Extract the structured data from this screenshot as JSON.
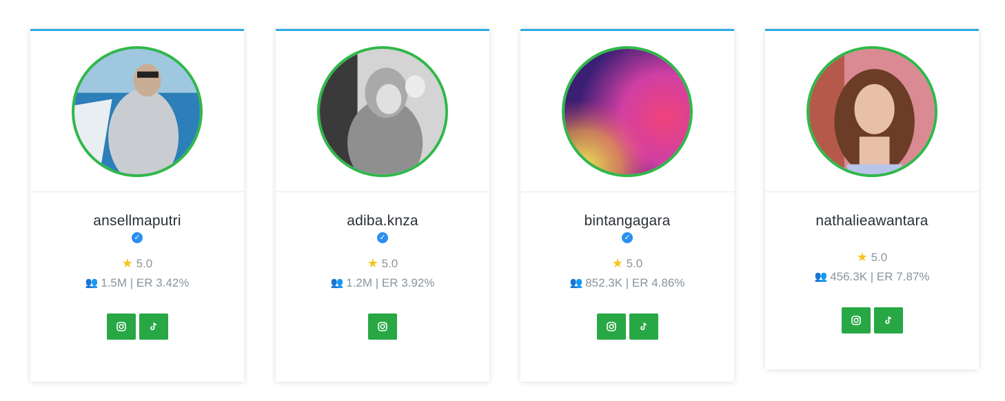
{
  "cards": [
    {
      "username": "ansellmaputri",
      "verified": true,
      "rating": "5.0",
      "stats": "1.5M | ER 3.42%",
      "buttons": [
        "instagram-icon",
        "tiktok-icon"
      ]
    },
    {
      "username": "adiba.knza",
      "verified": true,
      "rating": "5.0",
      "stats": "1.2M | ER 3.92%",
      "buttons": [
        "instagram-icon"
      ]
    },
    {
      "username": "bintangagara",
      "verified": true,
      "rating": "5.0",
      "stats": "852.3K | ER 4.86%",
      "buttons": [
        "instagram-icon",
        "tiktok-icon"
      ]
    },
    {
      "username": "nathalieawantara",
      "verified": false,
      "rating": "5.0",
      "stats": "456.3K | ER 7.87%",
      "buttons": [
        "instagram-icon",
        "tiktok-icon"
      ]
    }
  ],
  "colors": {
    "accent_top": "#29abe2",
    "avatar_border": "#2fb84a",
    "button": "#28a745",
    "star": "#f5c41b",
    "verified": "#2b8ff0"
  }
}
